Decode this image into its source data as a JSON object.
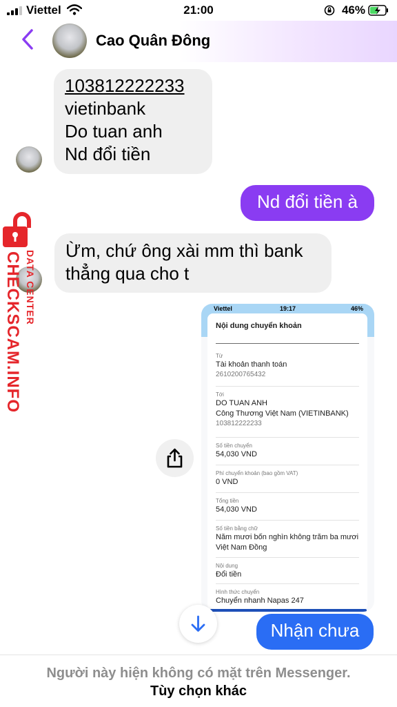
{
  "status_bar": {
    "carrier": "Viettel",
    "time": "21:00",
    "battery": "46%"
  },
  "header": {
    "contact_name": "Cao Quân Đông",
    "accent_color": "#8a3cf2"
  },
  "messages": {
    "incoming_1": {
      "account_number": "103812222233",
      "bank": "vietinbank",
      "recipient": "Do tuan anh",
      "note": "Nd đổi tiền"
    },
    "outgoing_1": "Nd đổi tiền à",
    "incoming_2": "Ừm, chứ ông xài mm thì bank thẳng qua cho t",
    "outgoing_2": "Nhận chưa"
  },
  "watermark": {
    "main": "CHECKSCAM.INFO",
    "sub": "DATA CENTER",
    "color": "#e5262b"
  },
  "screenshot": {
    "status": {
      "carrier": "Viettel",
      "time": "19:17",
      "battery": "46%"
    },
    "title": "Nội dung chuyển khoản",
    "from_label": "Từ",
    "from_value": "Tài khoản thanh toán",
    "from_account": "2610200765432",
    "to_label": "Tới",
    "to_name": "DO TUAN ANH",
    "to_bank": "Công Thương Việt Nam (VIETINBANK)",
    "to_account": "103812222233",
    "amount_label": "Số tiền chuyển",
    "amount_value": "54,030 VND",
    "fee_label": "Phí chuyển khoản (bao gồm VAT)",
    "fee_value": "0 VND",
    "total_label": "Tổng tiền",
    "total_value": "54,030 VND",
    "words_label": "Số tiền bằng chữ",
    "words_value": "Năm mươi bốn nghìn không trăm ba mươi Việt Nam Đồng",
    "content_label": "Nội dung",
    "content_value": "Đổi tiền",
    "method_label": "Hình thức chuyển",
    "method_value": "Chuyển nhanh Napas 247"
  },
  "footer": {
    "note": "Người này hiện không có mặt trên Messenger.",
    "link": "Tùy chọn khác"
  }
}
